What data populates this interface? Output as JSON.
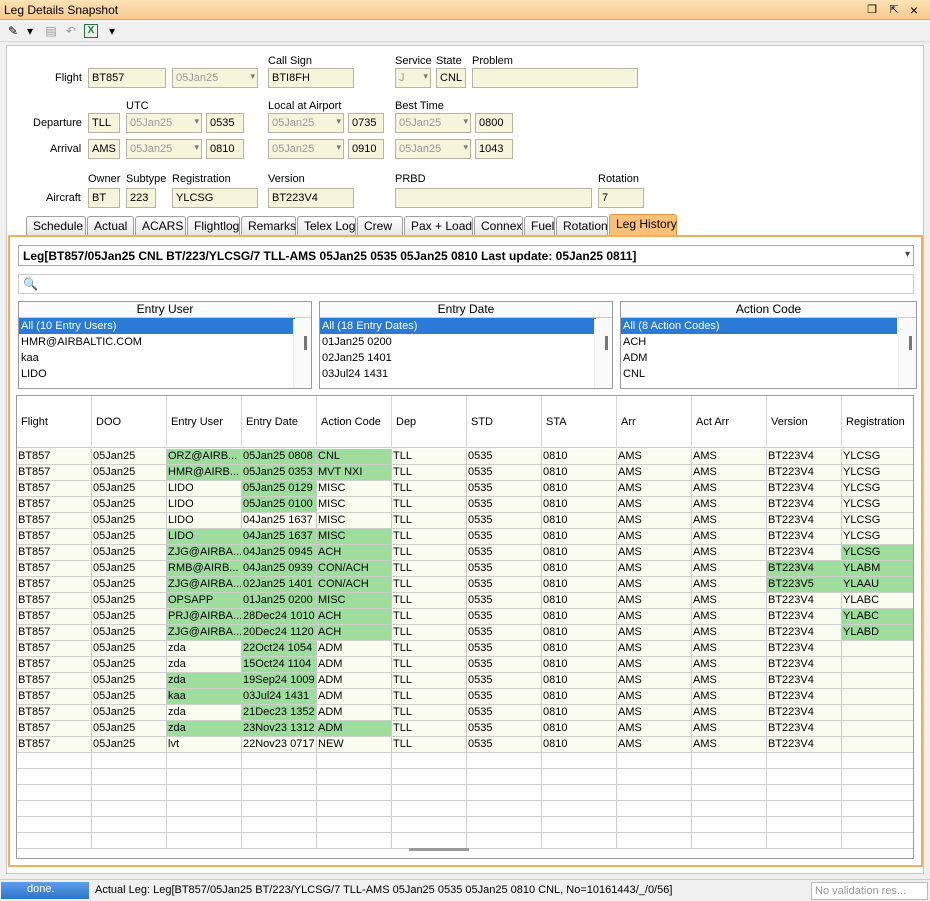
{
  "window": {
    "title": "Leg Details Snapshot",
    "restore_glyph": "❐",
    "pin_glyph": "⇱",
    "close_glyph": "×"
  },
  "toolbar": {
    "edit_icon": "✎",
    "dropdown_icon": "▾",
    "save_icon": "▤",
    "undo_icon": "↶",
    "excel_icon": "X",
    "more_icon": "▾"
  },
  "form": {
    "flight_label": "Flight",
    "flight": "BT857",
    "flight_date": "05Jan25",
    "callsign_label": "Call Sign",
    "callsign": "BTI8FH",
    "service_label": "Service",
    "service": "J",
    "state_label": "State",
    "state": "CNL",
    "problem_label": "Problem",
    "problem": "",
    "utc_label": "UTC",
    "local_label": "Local at Airport",
    "best_label": "Best Time",
    "departure_label": "Departure",
    "dep_airport": "TLL",
    "dep_utc_date": "05Jan25",
    "dep_utc_time": "0535",
    "dep_local_date": "05Jan25",
    "dep_local_time": "0735",
    "dep_best_date": "05Jan25",
    "dep_best_time": "0800",
    "arrival_label": "Arrival",
    "arr_airport": "AMS",
    "arr_utc_date": "05Jan25",
    "arr_utc_time": "0810",
    "arr_local_date": "05Jan25",
    "arr_local_time": "0910",
    "arr_best_date": "05Jan25",
    "arr_best_time": "1043",
    "aircraft_label": "Aircraft",
    "owner_label": "Owner",
    "owner": "BT",
    "subtype_label": "Subtype",
    "subtype": "223",
    "registration_label": "Registration",
    "registration": "YLCSG",
    "version_label": "Version",
    "version": "BT223V4",
    "prbd_label": "PRBD",
    "prbd": "",
    "rotation_label": "Rotation",
    "rotation": "7"
  },
  "tabs": [
    "Schedule",
    "Actual",
    "ACARS",
    "Flightlog",
    "Remarks",
    "Telex Log",
    "Crew",
    "Pax + Load",
    "Connex",
    "Fuel",
    "Rotation",
    "Leg History"
  ],
  "leg_history": {
    "leg_select": "Leg[BT857/05Jan25 CNL BT/223/YLCSG/7 TLL-AMS 05Jan25 0535 05Jan25 0810 Last update: 05Jan25 0811]",
    "search_icon": "🔍",
    "filters": [
      {
        "header": "Entry User",
        "items": [
          "All (10 Entry Users)",
          "HMR@AIRBALTIC.COM",
          "kaa",
          "LIDO"
        ]
      },
      {
        "header": "Entry Date",
        "items": [
          "All (18 Entry Dates)",
          "01Jan25 0200",
          "02Jan25 1401",
          "03Jul24 1431"
        ]
      },
      {
        "header": "Action Code",
        "items": [
          "All (8 Action Codes)",
          "ACH",
          "ADM",
          "CNL"
        ]
      }
    ],
    "columns": [
      "Flight",
      "DOO",
      "Entry User",
      "Entry Date",
      "Action Code",
      "Dep",
      "STD",
      "STA",
      "Arr",
      "Act Arr",
      "Version",
      "Registration"
    ],
    "rows": [
      {
        "c": [
          "BT857",
          "05Jan25",
          "ORZ@AIRB...",
          "05Jan25 0808",
          "CNL",
          "TLL",
          "0535",
          "0810",
          "AMS",
          "AMS",
          "BT223V4",
          "YLCSG"
        ],
        "h": [
          2,
          3,
          4
        ]
      },
      {
        "c": [
          "BT857",
          "05Jan25",
          "HMR@AIRB...",
          "05Jan25 0353",
          "MVT NXI",
          "TLL",
          "0535",
          "0810",
          "AMS",
          "AMS",
          "BT223V4",
          "YLCSG"
        ],
        "h": [
          2,
          3,
          4
        ]
      },
      {
        "c": [
          "BT857",
          "05Jan25",
          "LIDO",
          "05Jan25 0129",
          "MISC",
          "TLL",
          "0535",
          "0810",
          "AMS",
          "AMS",
          "BT223V4",
          "YLCSG"
        ],
        "h": [
          3
        ]
      },
      {
        "c": [
          "BT857",
          "05Jan25",
          "LIDO",
          "05Jan25 0100",
          "MISC",
          "TLL",
          "0535",
          "0810",
          "AMS",
          "AMS",
          "BT223V4",
          "YLCSG"
        ],
        "h": [
          3
        ]
      },
      {
        "c": [
          "BT857",
          "05Jan25",
          "LIDO",
          "04Jan25 1637",
          "MISC",
          "TLL",
          "0535",
          "0810",
          "AMS",
          "AMS",
          "BT223V4",
          "YLCSG"
        ],
        "h": []
      },
      {
        "c": [
          "BT857",
          "05Jan25",
          "LIDO",
          "04Jan25 1637",
          "MISC",
          "TLL",
          "0535",
          "0810",
          "AMS",
          "AMS",
          "BT223V4",
          "YLCSG"
        ],
        "h": [
          2,
          3,
          4
        ]
      },
      {
        "c": [
          "BT857",
          "05Jan25",
          "ZJG@AIRBA...",
          "04Jan25 0945",
          "ACH",
          "TLL",
          "0535",
          "0810",
          "AMS",
          "AMS",
          "BT223V4",
          "YLCSG"
        ],
        "h": [
          2,
          3,
          4,
          11
        ]
      },
      {
        "c": [
          "BT857",
          "05Jan25",
          "RMB@AIRB...",
          "04Jan25 0939",
          "CON/ACH",
          "TLL",
          "0535",
          "0810",
          "AMS",
          "AMS",
          "BT223V4",
          "YLABM"
        ],
        "h": [
          2,
          3,
          4,
          10,
          11
        ]
      },
      {
        "c": [
          "BT857",
          "05Jan25",
          "ZJG@AIRBA...",
          "02Jan25 1401",
          "CON/ACH",
          "TLL",
          "0535",
          "0810",
          "AMS",
          "AMS",
          "BT223V5",
          "YLAAU"
        ],
        "h": [
          2,
          3,
          4,
          10,
          11
        ]
      },
      {
        "c": [
          "BT857",
          "05Jan25",
          "OPSAPP",
          "01Jan25 0200",
          "MISC",
          "TLL",
          "0535",
          "0810",
          "AMS",
          "AMS",
          "BT223V4",
          "YLABC"
        ],
        "h": [
          2,
          3,
          4
        ]
      },
      {
        "c": [
          "BT857",
          "05Jan25",
          "PRJ@AIRBA...",
          "28Dec24 1010",
          "ACH",
          "TLL",
          "0535",
          "0810",
          "AMS",
          "AMS",
          "BT223V4",
          "YLABC"
        ],
        "h": [
          2,
          3,
          4,
          11
        ]
      },
      {
        "c": [
          "BT857",
          "05Jan25",
          "ZJG@AIRBA...",
          "20Dec24 1120",
          "ACH",
          "TLL",
          "0535",
          "0810",
          "AMS",
          "AMS",
          "BT223V4",
          "YLABD"
        ],
        "h": [
          2,
          3,
          4,
          11
        ]
      },
      {
        "c": [
          "BT857",
          "05Jan25",
          "zda",
          "22Oct24 1054",
          "ADM",
          "TLL",
          "0535",
          "0810",
          "AMS",
          "AMS",
          "BT223V4",
          ""
        ],
        "h": [
          3
        ]
      },
      {
        "c": [
          "BT857",
          "05Jan25",
          "zda",
          "15Oct24 1104",
          "ADM",
          "TLL",
          "0535",
          "0810",
          "AMS",
          "AMS",
          "BT223V4",
          ""
        ],
        "h": [
          3
        ]
      },
      {
        "c": [
          "BT857",
          "05Jan25",
          "zda",
          "19Sep24 1009",
          "ADM",
          "TLL",
          "0535",
          "0810",
          "AMS",
          "AMS",
          "BT223V4",
          ""
        ],
        "h": [
          2,
          3
        ]
      },
      {
        "c": [
          "BT857",
          "05Jan25",
          "kaa",
          "03Jul24 1431",
          "ADM",
          "TLL",
          "0535",
          "0810",
          "AMS",
          "AMS",
          "BT223V4",
          ""
        ],
        "h": [
          2,
          3
        ]
      },
      {
        "c": [
          "BT857",
          "05Jan25",
          "zda",
          "21Dec23 1352",
          "ADM",
          "TLL",
          "0535",
          "0810",
          "AMS",
          "AMS",
          "BT223V4",
          ""
        ],
        "h": [
          3
        ]
      },
      {
        "c": [
          "BT857",
          "05Jan25",
          "zda",
          "23Nov23 1312",
          "ADM",
          "TLL",
          "0535",
          "0810",
          "AMS",
          "AMS",
          "BT223V4",
          ""
        ],
        "h": [
          2,
          3,
          4
        ]
      },
      {
        "c": [
          "BT857",
          "05Jan25",
          "lvt",
          "22Nov23 0717",
          "NEW",
          "TLL",
          "0535",
          "0810",
          "AMS",
          "AMS",
          "BT223V4",
          ""
        ],
        "h": []
      }
    ]
  },
  "status": {
    "done": "done.",
    "message": "Actual Leg: Leg[BT857/05Jan25 BT/223/YLCSG/7 TLL-AMS 05Jan25 0535 05Jan25 0810 CNL, No=10161443/_/0/56]",
    "validation": "No validation res..."
  }
}
